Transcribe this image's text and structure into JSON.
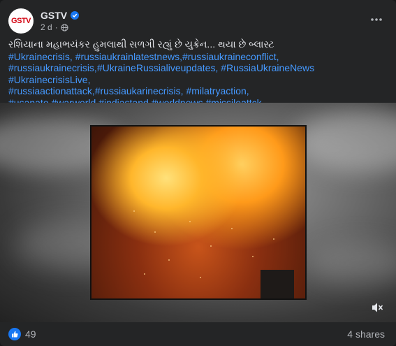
{
  "post": {
    "page_name": "GSTV",
    "avatar_text": "GSTV",
    "time": "2 d",
    "headline": "રશિયાના મહાભયંકર હુમલાથી સળગી રહ્યું છે યુક્રેન... થયા છે બ્લાસ્ટ",
    "hashtag_lines": [
      "#Ukrainecrisis, #russiaukrainlatestnews,#russiaukraineconflict,",
      "#russiaukrainecrisis,#UkraineRussialiveupdates, #RussiaUkraineNews #UkrainecrisisLive,",
      "#russiaactionattack,#russiaukarinecrisis, #milatryaction,",
      "#usanato,#warworld,#indiastand,#worldnews,#missileattck,"
    ]
  },
  "footer": {
    "reaction_count": "49",
    "shares": "4 shares"
  },
  "colors": {
    "card_bg": "#242526",
    "hashtag": "#4599ff",
    "like_blue": "#1877f2"
  },
  "icons": [
    "verified-icon",
    "globe-icon",
    "more-icon",
    "mute-icon",
    "like-icon"
  ]
}
